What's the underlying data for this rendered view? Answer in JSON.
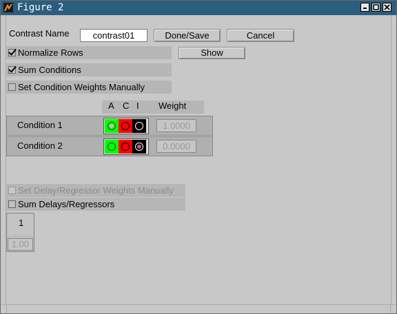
{
  "window": {
    "title": "Figure 2",
    "controls": [
      "_",
      "□",
      "×"
    ]
  },
  "contrast_name": {
    "label": "Contrast Name",
    "value": "contrast01"
  },
  "buttons": {
    "done_save": "Done/Save",
    "cancel": "Cancel",
    "show": "Show"
  },
  "checkboxes": {
    "normalize_rows": {
      "label": "Normalize Rows",
      "checked": true
    },
    "sum_conditions": {
      "label": "Sum Conditions",
      "checked": true
    },
    "set_condition_weights": {
      "label": "Set Condition Weights Manually",
      "checked": false
    },
    "set_delay_weights": {
      "label": "Set Delay/Regressor Weights Manually",
      "checked": false,
      "disabled": true
    },
    "sum_delays": {
      "label": "Sum Delays/Regressors",
      "checked": false
    }
  },
  "condition_table": {
    "headers": {
      "a": "A",
      "c": "C",
      "i": "I",
      "weight": "Weight"
    },
    "rows": [
      {
        "label": "Condition 1",
        "selected": "A",
        "weight": "1.0000"
      },
      {
        "label": "Condition 2",
        "selected": "I",
        "weight": "0.0000"
      }
    ],
    "colors": {
      "a": "#00ff00",
      "c": "#ff0000",
      "i": "#000000"
    }
  },
  "delay_table": {
    "header": "1",
    "value": "1.00"
  }
}
